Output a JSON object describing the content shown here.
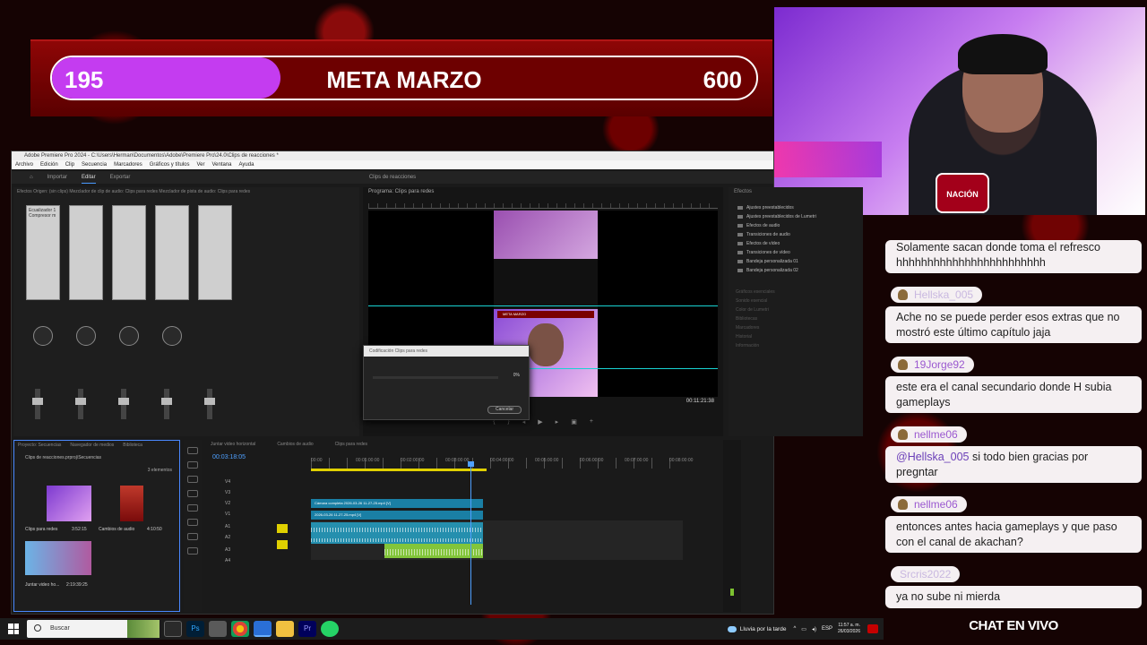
{
  "goal": {
    "current": "195",
    "title": "META MARZO",
    "target": "600",
    "progress": 0.325,
    "fill_color": "#c43cf0"
  },
  "webcam": {
    "logo_text": "NACIÓN AKACHAN"
  },
  "premiere": {
    "window_title": "Adobe Premiere Pro 2024 - C:\\Users\\Herman\\Documentos\\Adobe\\Premiere Pro\\24.0\\Clips de reacciones *",
    "menu": [
      "Archivo",
      "Edición",
      "Clip",
      "Secuencia",
      "Marcadores",
      "Gráficos y títulos",
      "Ver",
      "Ventana",
      "Ayuda"
    ],
    "workspaces": [
      "Inicio",
      "Importar",
      "Editar",
      "Exportar"
    ],
    "workspace_center": "Clips de reacciones",
    "mixer": {
      "tabs": "Efectos   Origen: (sin clips)   Mezclador de clip de audio: Clips para redes   Mezclador de pista de audio: Clips para redes",
      "first_label": "Ecualizador 1 Compresor m"
    },
    "program": {
      "tab": "Programa: Clips para redes",
      "timecode": "00:11:21:38",
      "frame_title": "META MARZO"
    },
    "encode": {
      "title": "Codificación Clips para redes",
      "percent": "0%",
      "cancel": "Cancelar"
    },
    "effects": {
      "tab": "Efectos",
      "items": [
        "Ajustes preestablecidos",
        "Ajustes preestablecidos de Lumetri",
        "Efectos de audio",
        "Transiciones de audio",
        "Efectos de vídeo",
        "Transiciones de vídeo",
        "Bandeja personalizada 01",
        "Bandeja personalizada 02"
      ],
      "panels": [
        "Gráficos esenciales",
        "Sonido esencial",
        "Color de Lumetri",
        "Bibliotecas",
        "Marcadores",
        "Historial",
        "Información"
      ]
    },
    "project": {
      "tabs": [
        "Proyecto: Secuencias",
        "Navegador de medios",
        "Biblioteca"
      ],
      "path": "Clips de reacciones.prproj\\Secuencias",
      "count": "3 elementos",
      "items": [
        {
          "name": "Clips para redes",
          "duration": "3:52:15"
        },
        {
          "name": "Cambios de audio",
          "duration": "4:10:50"
        },
        {
          "name": "Juntar video ho...",
          "duration": "2:19:39:25"
        }
      ]
    },
    "timeline": {
      "tabs": [
        "Juntar video horizontal",
        "Cambios de audio",
        "Clips para redes"
      ],
      "timecode": "00:03:18:05",
      "ruler": [
        "00:00",
        "00:01:00:00",
        "00:02:00:00",
        "00:03:00:00",
        "00:04:00:00",
        "00:05:00:00",
        "00:06:00:00",
        "00:07:00:00",
        "00:08:00:00"
      ],
      "tracks": [
        "V4",
        "V3",
        "V2",
        "V1",
        "A1",
        "A2",
        "A3",
        "A4"
      ],
      "clip_v2": "Cámara completa 2026-03-26 11-27-25.mp4 [V]",
      "clip_v1": "2026-03-26 11-27-25.mp4 [V]"
    }
  },
  "chat": {
    "messages": [
      {
        "user": "",
        "text": "Solamente sacan donde toma el refresco hhhhhhhhhhhhhhhhhhhhhhhh",
        "faded": false
      },
      {
        "user": "Hellska_005",
        "text": "Ache no se puede perder esos extras que no mostró este último capítulo jaja",
        "faded": true
      },
      {
        "user": "19Jorge92",
        "text": "este era el canal secundario donde H subia gameplays",
        "faded": false
      },
      {
        "user": "nellme06",
        "mention": "@Hellska_005",
        "text": " si todo bien gracias por pregntar",
        "faded": false
      },
      {
        "user": "nellme06",
        "text": "entonces antes hacia gameplays y que paso con el canal de akachan?",
        "faded": false
      },
      {
        "user": "Srcris2022",
        "text": "ya no sube ni mierda",
        "faded": true
      }
    ],
    "footer": "CHAT EN VIVO"
  },
  "taskbar": {
    "search_placeholder": "Buscar",
    "weather": "Lluvia por la tarde",
    "lang": "ESP",
    "time": "11:57 a. m.",
    "date": "26/03/2026"
  }
}
